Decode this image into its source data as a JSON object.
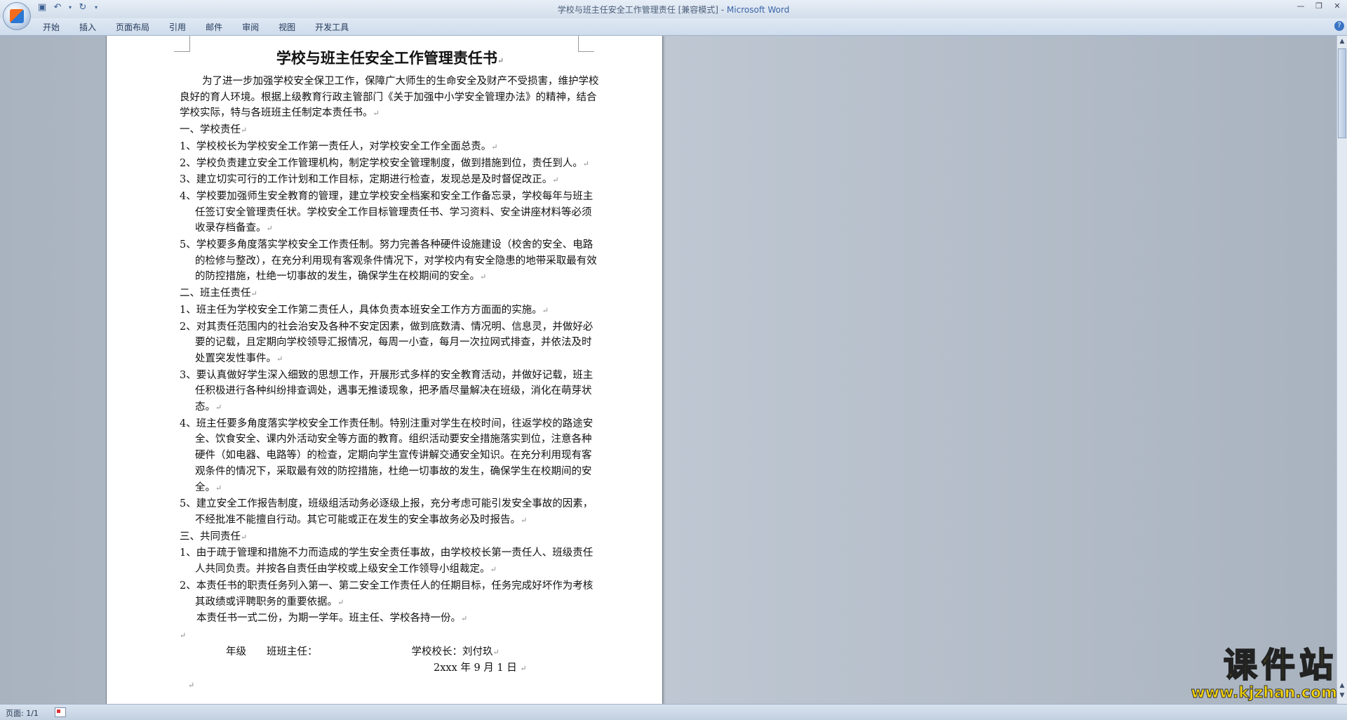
{
  "window": {
    "title_doc": "学校与班主任安全工作管理责任 [兼容模式] - ",
    "title_app": "Microsoft Word"
  },
  "ribbon": {
    "tabs": [
      "开始",
      "插入",
      "页面布局",
      "引用",
      "邮件",
      "审阅",
      "视图",
      "开发工具"
    ]
  },
  "document": {
    "title": "学校与班主任安全工作管理责任书",
    "intro": "为了进一步加强学校安全保卫工作，保障广大师生的生命安全及财产不受损害，维护学校良好的育人环境。根据上级教育行政主管部门《关于加强中小学安全管理办法》的精神，结合学校实际，特与各班班主任制定本责任书。",
    "section1": "一、学校责任",
    "s1_items": [
      "1、学校校长为学校安全工作第一责任人，对学校安全工作全面总责。",
      "2、学校负责建立安全工作管理机构，制定学校安全管理制度，做到措施到位，责任到人。",
      "3、建立切实可行的工作计划和工作目标，定期进行检查，发现总是及时督促改正。",
      "4、学校要加强师生安全教育的管理，建立学校安全档案和安全工作备忘录，学校每年与班主任签订安全管理责任状。学校安全工作目标管理责任书、学习资料、安全讲座材料等必须收录存档备查。",
      "5、学校要多角度落实学校安全工作责任制。努力完善各种硬件设施建设（校舍的安全、电路的检修与整改），在充分利用现有客观条件情况下，对学校内有安全隐患的地带采取最有效的防控措施，杜绝一切事故的发生，确保学生在校期间的安全。"
    ],
    "section2": "二、班主任责任",
    "s2_items": [
      "1、班主任为学校安全工作第二责任人，具体负责本班安全工作方方面面的实施。",
      "2、对其责任范围内的社会治安及各种不安定因素，做到底数清、情况明、信息灵，并做好必要的记载，且定期向学校领导汇报情况，每周一小查，每月一次拉网式排查，并依法及时处置突发性事件。",
      "3、要认真做好学生深入细致的思想工作，开展形式多样的安全教育活动，并做好记载，班主任积极进行各种纠纷排查调处，遇事无推诿现象，把矛盾尽量解决在班级，消化在萌芽状态。",
      "4、班主任要多角度落实学校安全工作责任制。特别注重对学生在校时间，往返学校的路途安全、饮食安全、课内外活动安全等方面的教育。组织活动要安全措施落实到位，注意各种硬件（如电器、电路等）的检查，定期向学生宣传讲解交通安全知识。在充分利用现有客观条件的情况下，采取最有效的防控措施，杜绝一切事故的发生，确保学生在校期间的安全。",
      "5、建立安全工作报告制度，班级组活动务必逐级上报，充分考虑可能引发安全事故的因素，不经批准不能擅自行动。其它可能或正在发生的安全事故务必及时报告。"
    ],
    "section3": "三、共同责任",
    "s3_items": [
      "1、由于疏于管理和措施不力而造成的学生安全责任事故，由学校校长第一责任人、班级责任人共同负责。并按各自责任由学校或上级安全工作领导小组裁定。",
      "2、本责任书的职责任务列入第一、第二安全工作责任人的任期目标，任务完成好坏作为考核其政绩或评聘职务的重要依据。"
    ],
    "closing": "本责任书一式二份，为期一学年。班主任、学校各持一份。",
    "sig_left": "年级　　班班主任：",
    "sig_right": "学校校长：刘付玖",
    "date": "2xxx 年 9 月 1 日",
    "para_mark": "↵"
  },
  "status": {
    "page": "页面: 1/1"
  },
  "watermark": {
    "text": "课件站",
    "url": "www.kjzhan.com"
  }
}
